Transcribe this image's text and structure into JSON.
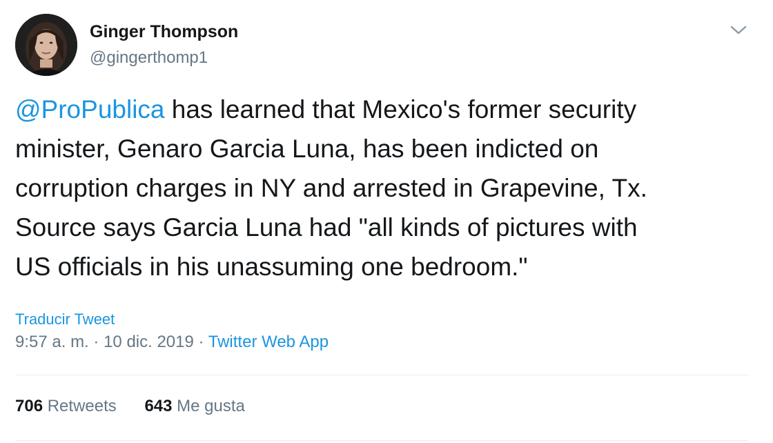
{
  "user": {
    "display_name": "Ginger Thompson",
    "handle": "@gingerthomp1",
    "avatar_icon": "avatar-photo"
  },
  "tweet": {
    "mention": "@ProPublica",
    "lines": [
      " has learned that Mexico's former security",
      "minister, Genaro Garcia Luna, has been indicted on",
      "corruption charges in NY and arrested in Grapevine, Tx.",
      "Source says Garcia Luna had \"all kinds of pictures with",
      "US officials in his unassuming one bedroom.\""
    ],
    "translate_label": "Traducir Tweet",
    "time": "9:57 a. m.",
    "sep1": "·",
    "date": "10 dic. 2019",
    "sep2": "·",
    "source": "Twitter Web App"
  },
  "stats": {
    "retweets_count": "706",
    "retweets_label": "Retweets",
    "likes_count": "643",
    "likes_label": "Me gusta"
  },
  "colors": {
    "link": "#1b95e0",
    "text": "#14171a",
    "muted": "#657786",
    "divider": "#e6ecf0"
  },
  "icons": {
    "menu": "chevron-down-icon"
  }
}
